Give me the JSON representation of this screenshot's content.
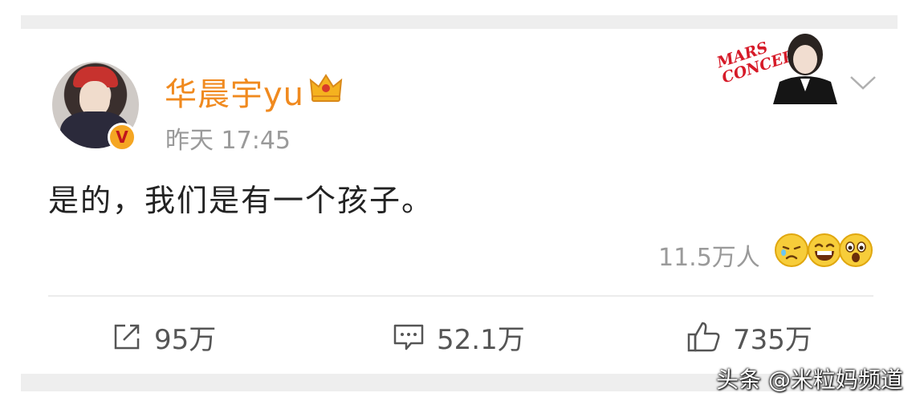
{
  "post": {
    "username": "华晨宇yu",
    "time": "昨天 17:45",
    "verified_badge": "V",
    "content": "是的，我们是有一个孩子。",
    "reactions_count": "11.5万人",
    "reaction_icons": [
      "sad-tear-emoji-icon",
      "laughing-emoji-icon",
      "surprised-emoji-icon"
    ],
    "cover_tag": "MARS CONCERT"
  },
  "actions": {
    "share_count": "95万",
    "comment_count": "52.1万",
    "like_count": "735万"
  },
  "watermark": "头条 @米粒妈频道",
  "colors": {
    "username": "#f08a1f",
    "muted": "#9a9a9a",
    "text": "#222222",
    "badge": "#f5a623"
  }
}
